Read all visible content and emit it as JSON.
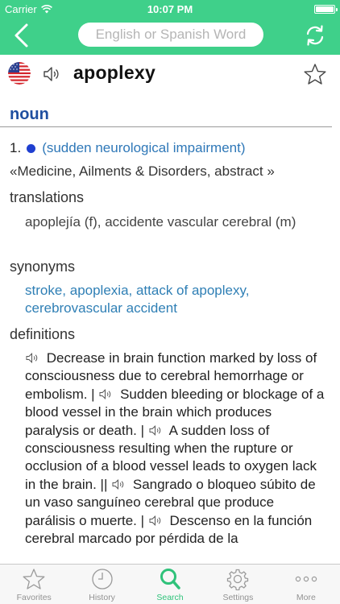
{
  "status_bar": {
    "carrier": "Carrier",
    "time": "10:07 PM"
  },
  "nav": {
    "search_placeholder": "English or Spanish Word"
  },
  "entry": {
    "headword": "apoplexy",
    "part_of_speech": "noun",
    "sense_number": "1.",
    "gloss": "(sudden neurological impairment)",
    "domain": "«Medicine, Ailments & Disorders, abstract »"
  },
  "translations": {
    "title": "translations",
    "text": "apoplejía (f), accidente vascular cerebral (m)"
  },
  "synonyms": {
    "title": "synonyms",
    "text": "stroke, apoplexia, attack of apoplexy, cerebrovascular accident"
  },
  "definitions": {
    "title": "definitions",
    "items": [
      "Decrease in brain function marked by loss of consciousness due to cerebral hemorrhage or embolism. |",
      "Sudden bleeding or blockage of a blood vessel in the brain which produces paralysis or death. |",
      "A sudden loss of consciousness resulting when the rupture or occlusion of a blood vessel leads to oxygen lack in the brain. ||",
      "Sangrado o bloqueo súbito de un vaso sanguíneo cerebral que produce parálisis o muerte. |",
      "Descenso en la función cerebral marcado por pérdida de la"
    ]
  },
  "tabs": [
    {
      "label": "Favorites",
      "icon": "star-icon",
      "active": false
    },
    {
      "label": "History",
      "icon": "clock-icon",
      "active": false
    },
    {
      "label": "Search",
      "icon": "search-icon",
      "active": true
    },
    {
      "label": "Settings",
      "icon": "gear-icon",
      "active": false
    },
    {
      "label": "More",
      "icon": "more-icon",
      "active": false
    }
  ],
  "colors": {
    "accent": "#3fd08a",
    "pos": "#1f4fa0",
    "link": "#2f7fb5",
    "active_tab": "#2fc27a"
  }
}
